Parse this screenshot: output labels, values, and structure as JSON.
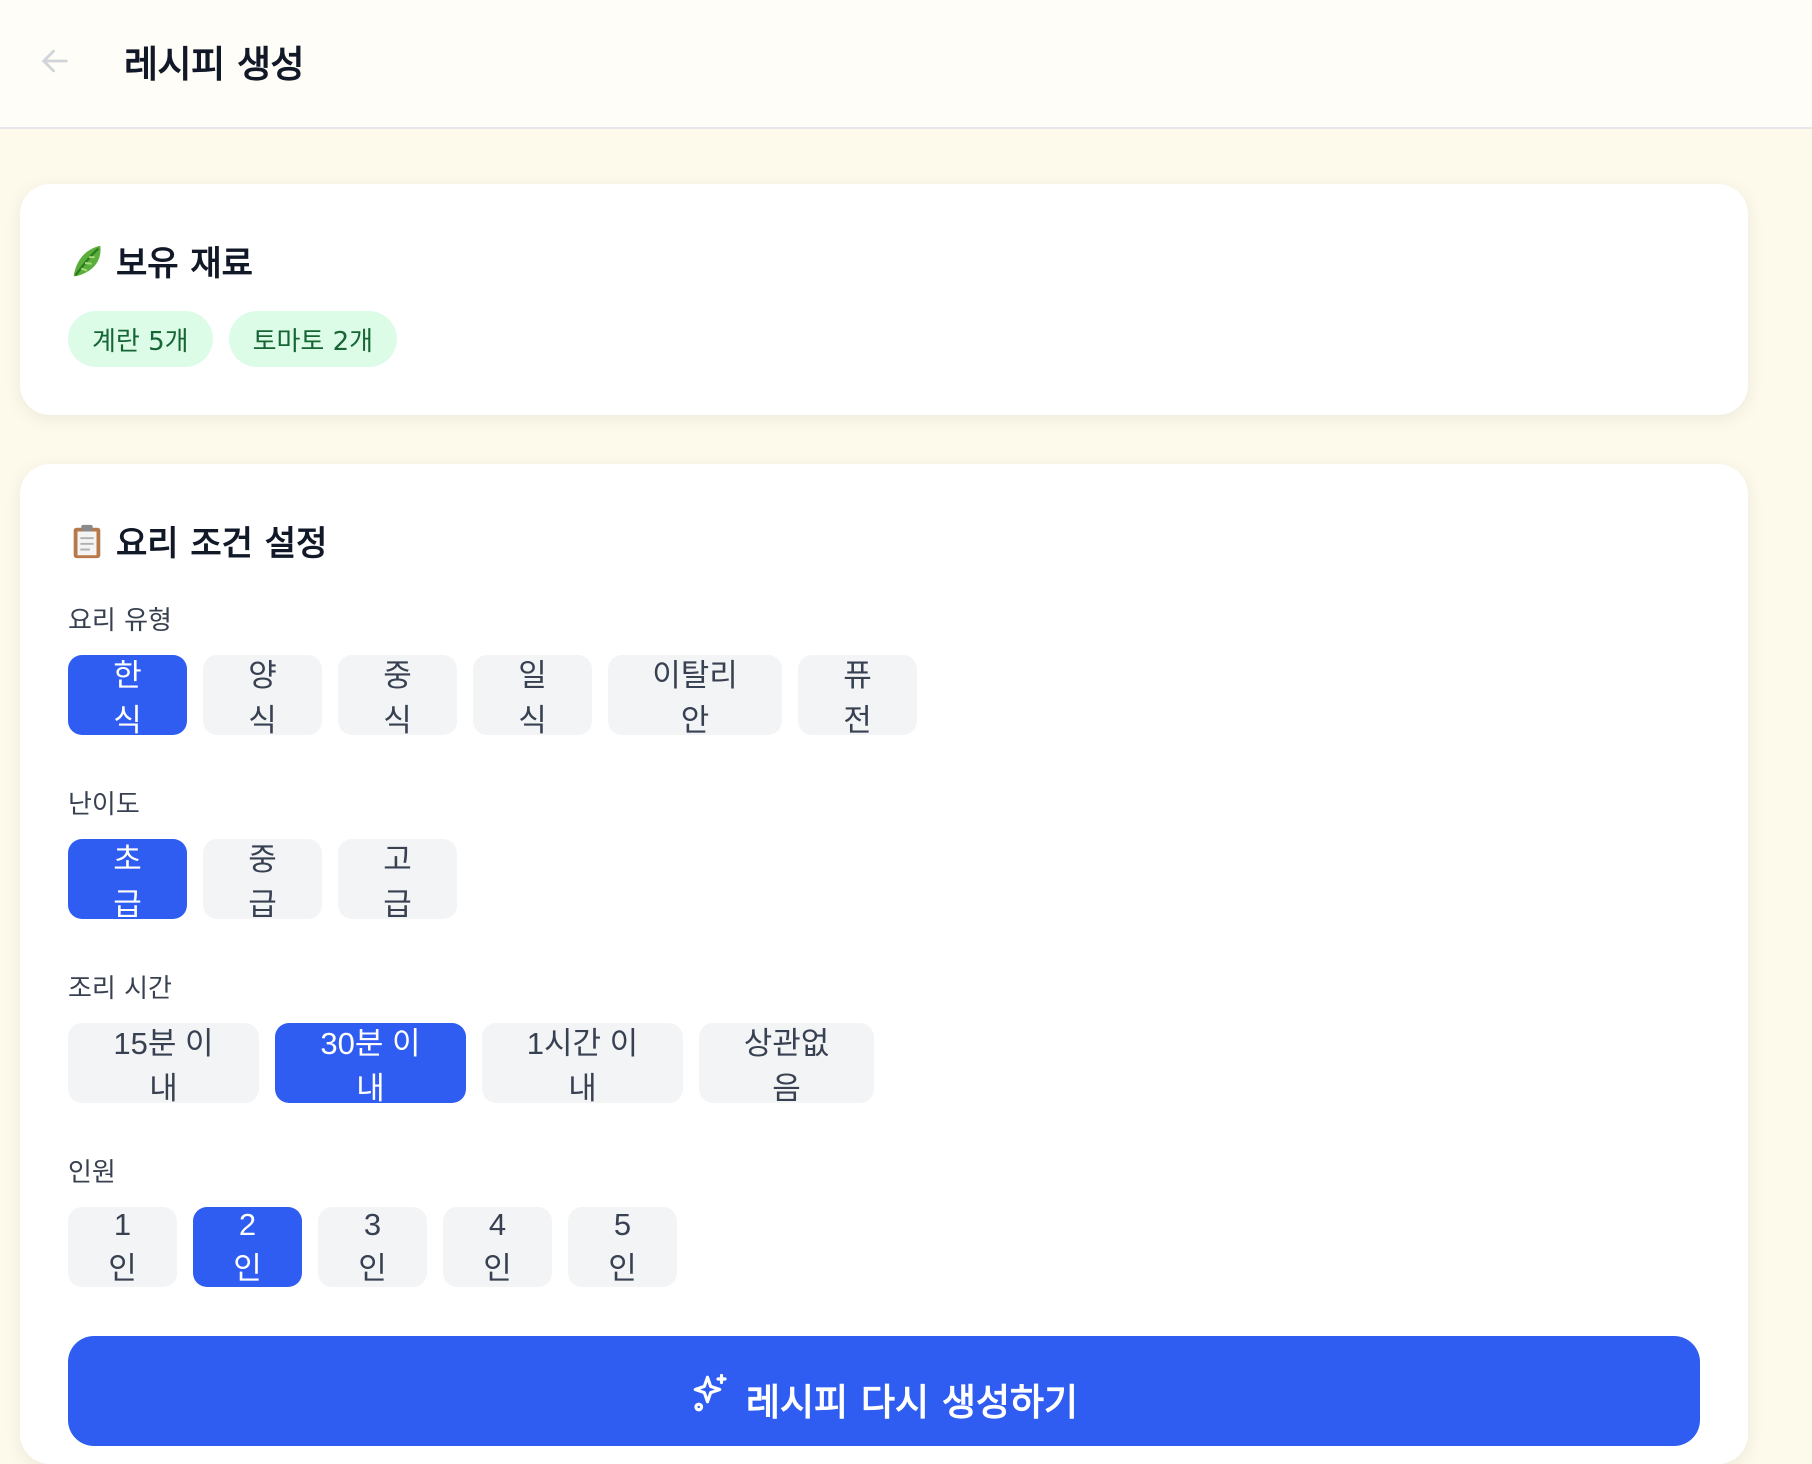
{
  "header": {
    "title": "레시피 생성"
  },
  "ingredients": {
    "title": "보유 재료",
    "items": [
      "계란 5개",
      "토마토 2개"
    ]
  },
  "conditions": {
    "title": "요리 조건 설정",
    "cuisine": {
      "label": "요리 유형",
      "options": [
        "한식",
        "양식",
        "중식",
        "일식",
        "이탈리안",
        "퓨전"
      ],
      "selected": "한식"
    },
    "difficulty": {
      "label": "난이도",
      "options": [
        "초급",
        "중급",
        "고급"
      ],
      "selected": "초급"
    },
    "time": {
      "label": "조리 시간",
      "options": [
        "15분 이내",
        "30분 이내",
        "1시간 이내",
        "상관없음"
      ],
      "selected": "30분 이내"
    },
    "servings": {
      "label": "인원",
      "options": [
        "1인",
        "2인",
        "3인",
        "4인",
        "5인"
      ],
      "selected": "2인"
    }
  },
  "generate_button": {
    "label": "레시피 다시 생성하기"
  },
  "colors": {
    "accent": "#2f5cf1",
    "chip_bg": "#dcfce7",
    "chip_text": "#166534",
    "page_bg": "#fdfaeb"
  }
}
